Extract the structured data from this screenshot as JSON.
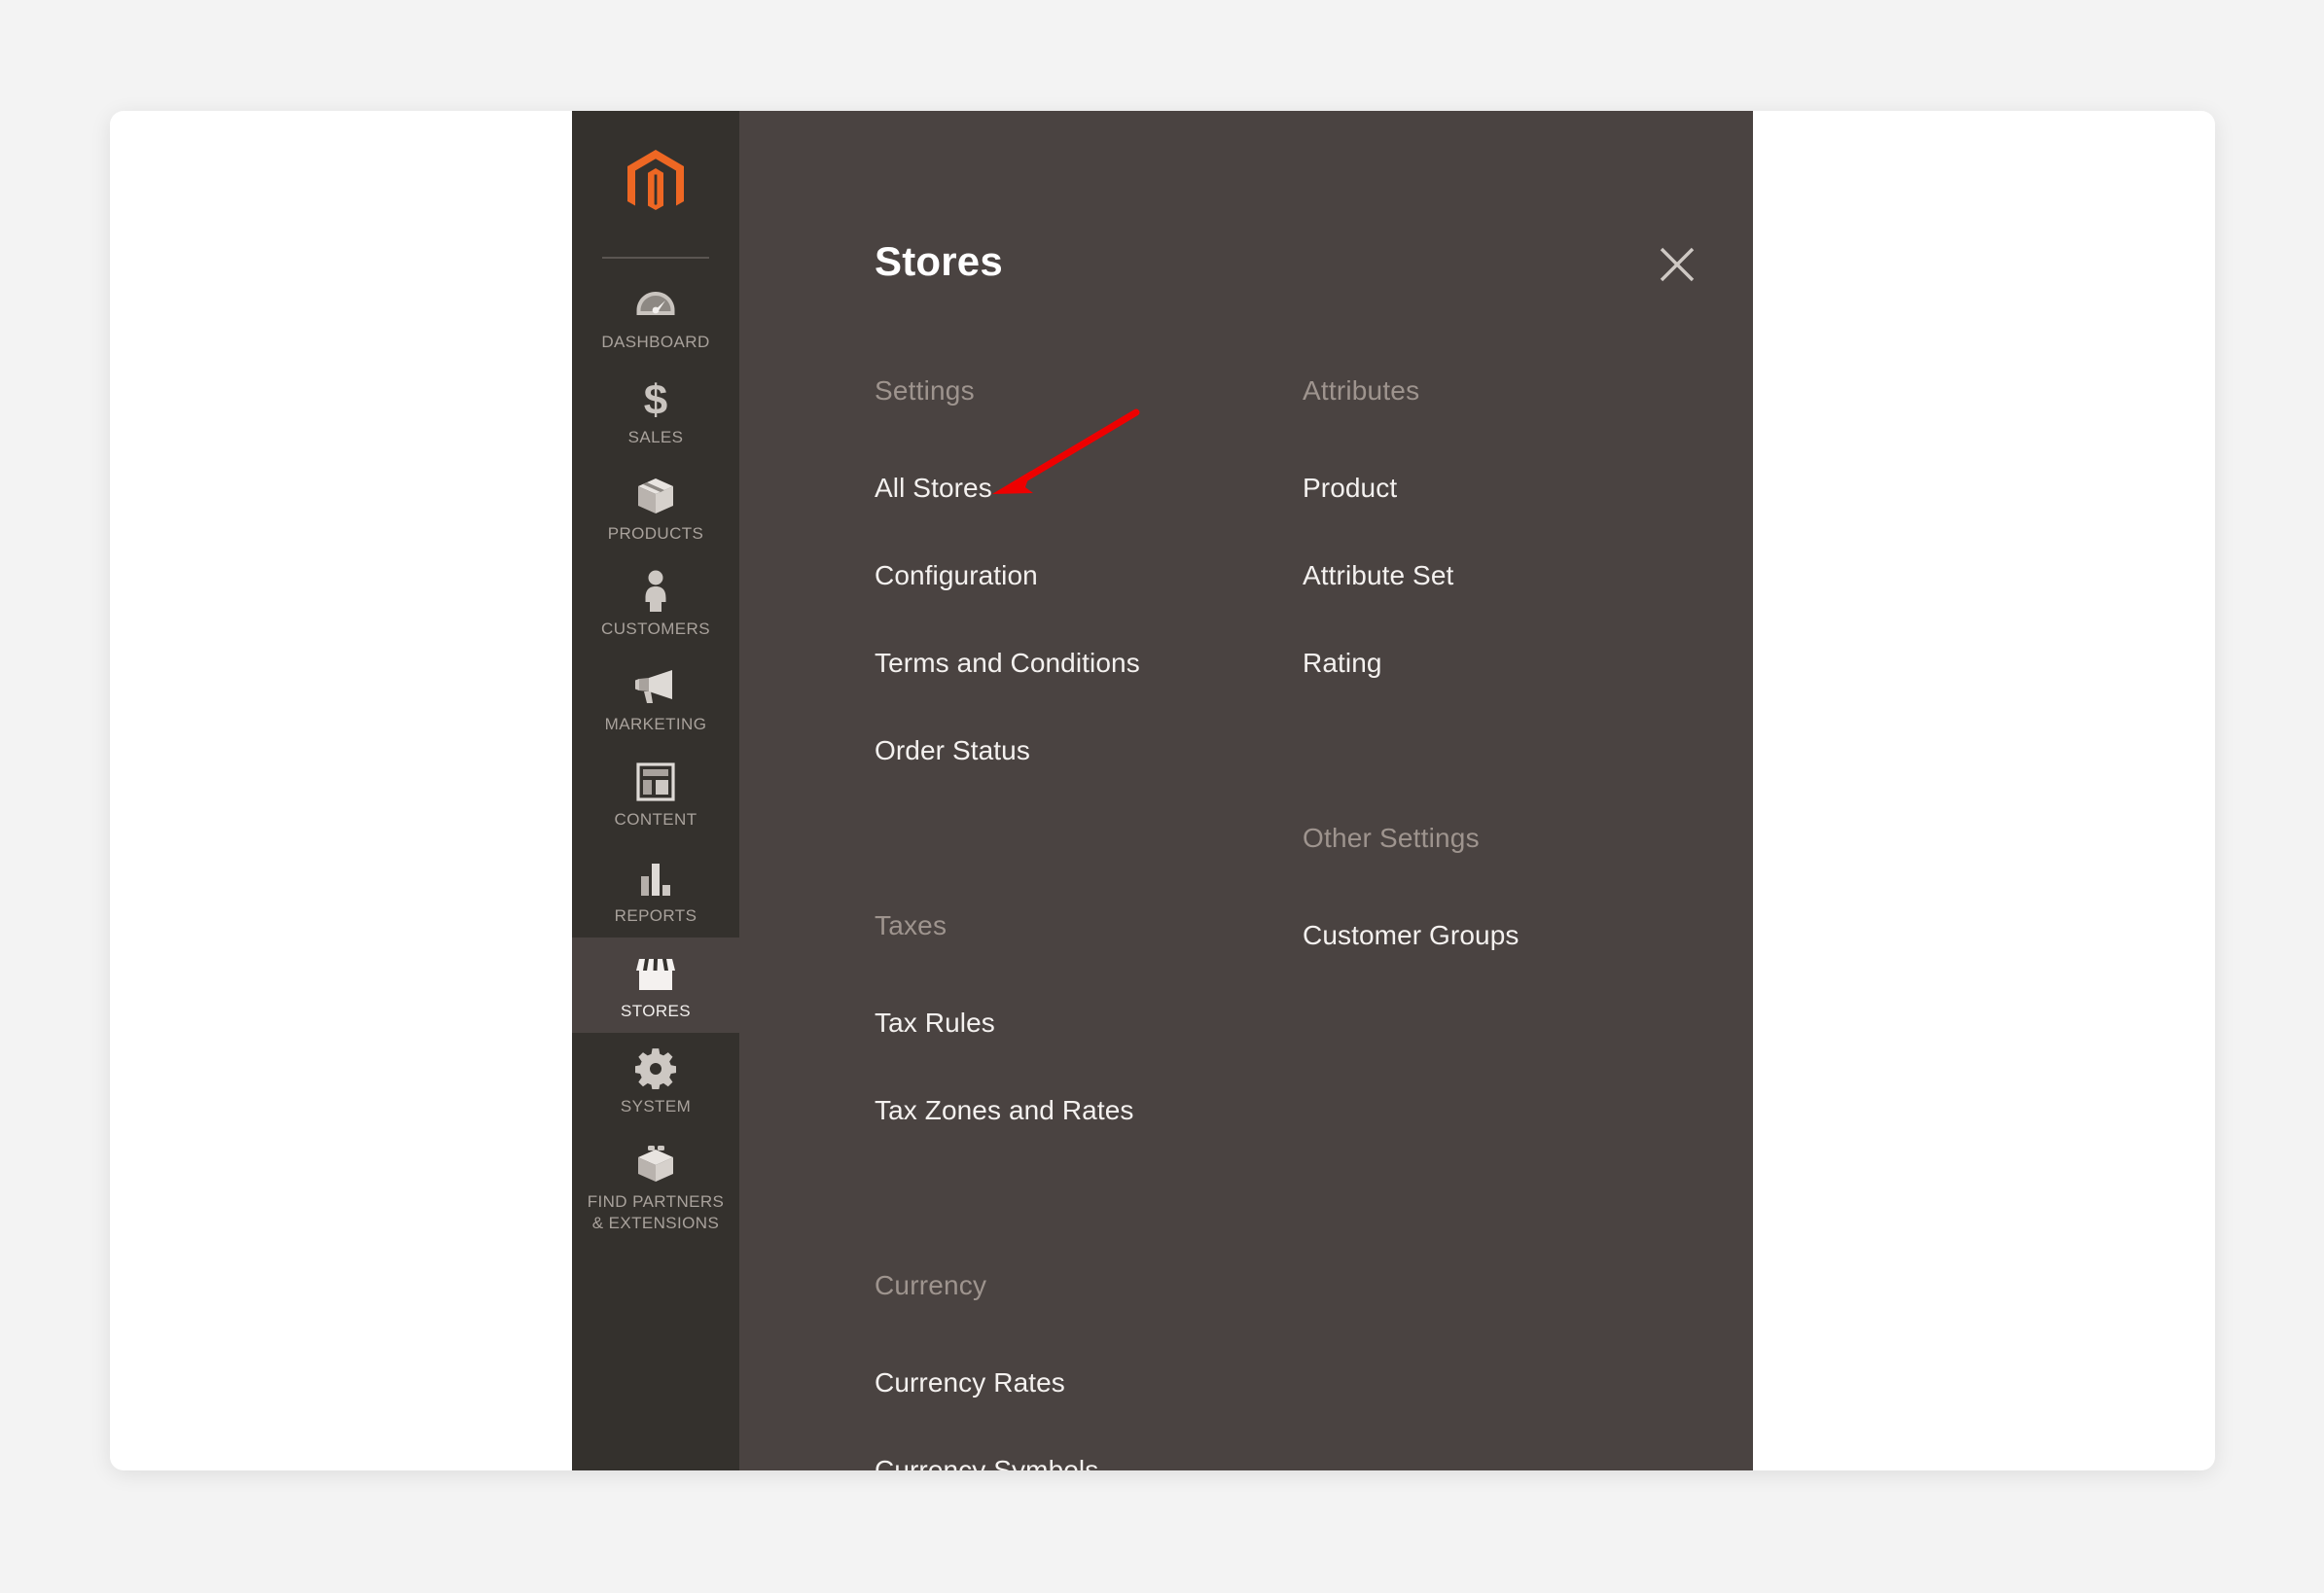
{
  "app": {
    "brand_color": "#ee6723",
    "sidebar_bg": "#34312d",
    "panel_bg": "#4a4341",
    "annotation_color": "#ee0000"
  },
  "sidebar": {
    "logo_name": "magento-logo",
    "items": [
      {
        "label": "DASHBOARD",
        "icon": "gauge-icon",
        "active": false
      },
      {
        "label": "SALES",
        "icon": "dollar-icon",
        "active": false
      },
      {
        "label": "PRODUCTS",
        "icon": "box-icon",
        "active": false
      },
      {
        "label": "CUSTOMERS",
        "icon": "person-icon",
        "active": false
      },
      {
        "label": "MARKETING",
        "icon": "megaphone-icon",
        "active": false
      },
      {
        "label": "CONTENT",
        "icon": "layout-icon",
        "active": false
      },
      {
        "label": "REPORTS",
        "icon": "bar-chart-icon",
        "active": false
      },
      {
        "label": "STORES",
        "icon": "storefront-icon",
        "active": true
      },
      {
        "label": "SYSTEM",
        "icon": "gear-icon",
        "active": false
      },
      {
        "label": "FIND PARTNERS\n& EXTENSIONS",
        "icon": "extension-box-icon",
        "active": false
      }
    ]
  },
  "flyout": {
    "title": "Stores",
    "close_icon": "close-icon",
    "left_column": [
      {
        "group": "Settings",
        "items": [
          "All Stores",
          "Configuration",
          "Terms and Conditions",
          "Order Status"
        ]
      },
      {
        "group": "Taxes",
        "items": [
          "Tax Rules",
          "Tax Zones and Rates"
        ]
      },
      {
        "group": "Currency",
        "items": [
          "Currency Rates",
          "Currency Symbols"
        ]
      }
    ],
    "right_column": [
      {
        "group": "Attributes",
        "items": [
          "Product",
          "Attribute Set",
          "Rating"
        ]
      },
      {
        "group": "Other Settings",
        "items": [
          "Customer Groups"
        ]
      }
    ]
  },
  "annotation": {
    "name": "red-arrow-pointing-to-configuration",
    "points_to": "Configuration"
  }
}
